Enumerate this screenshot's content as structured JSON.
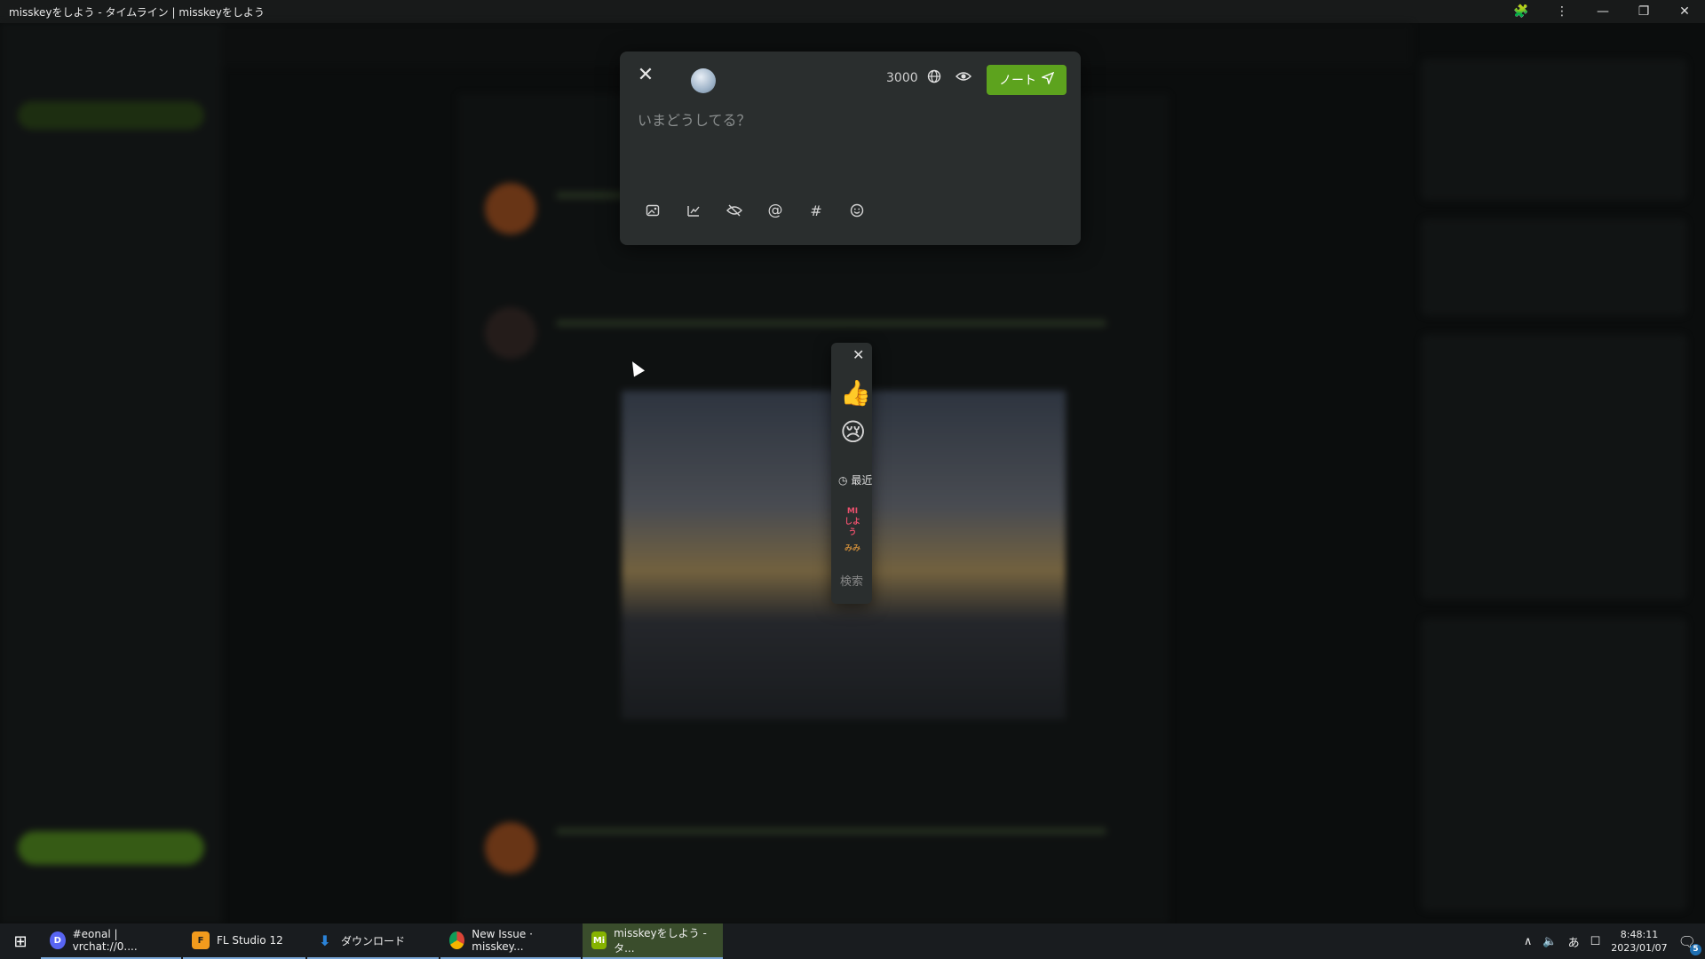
{
  "window": {
    "title": "misskeyをしよう - タイムライン | misskeyをしよう",
    "controls": [
      "🧩",
      "⋮",
      "—",
      "❐",
      "✕"
    ]
  },
  "compose": {
    "close_icon": "✕",
    "char_counter": "3000",
    "visibility_icon": "globe-icon",
    "local_only_icon": "eye-icon",
    "submit_label": "ノート",
    "submit_icon": "send-icon",
    "placeholder": "いまどうしてる？",
    "tools": [
      "image-add-icon",
      "poll-icon",
      "cw-hide-icon",
      "mention-icon",
      "hashtag-icon",
      "emoji-icon"
    ]
  },
  "emoji_picker": {
    "close_icon": "✕",
    "pinned": [
      "👍",
      "😢"
    ],
    "recent_label": "最近",
    "custom_emoji": [
      "MI しよう",
      "みみ"
    ],
    "search_placeholder": "検索"
  },
  "taskbar": {
    "start_icon": "windows-icon",
    "tasks": [
      {
        "label": "#eonal | vrchat://0....",
        "icon": "discord",
        "color": "#5865f2"
      },
      {
        "label": "FL Studio 12",
        "icon": "fl-studio",
        "color": "#f29b1d"
      },
      {
        "label": "ダウンロード",
        "icon": "download",
        "color": "#2b83d8"
      },
      {
        "label": "New Issue · misskey...",
        "icon": "chrome",
        "color": "#e0e0e0"
      },
      {
        "label": "misskeyをしよう - タ...",
        "icon": "misskey",
        "color": "#86b300"
      }
    ],
    "tray_ime": "あ",
    "time": "8:48:11",
    "date": "2023/01/07",
    "notification_count": "5"
  }
}
